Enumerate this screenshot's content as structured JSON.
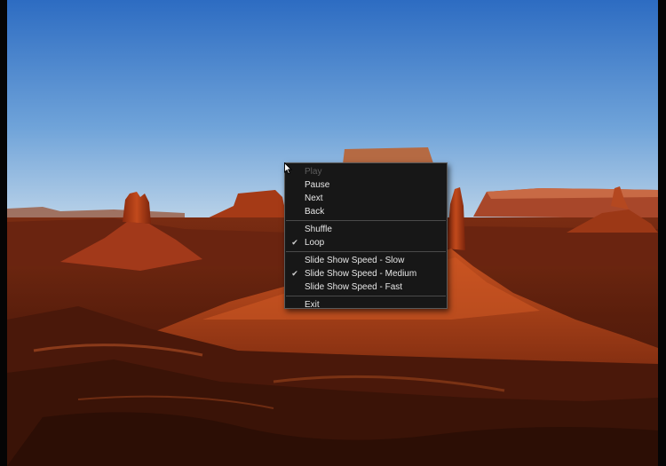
{
  "menu": {
    "items": [
      {
        "label": "Play",
        "enabled": false,
        "checked": false
      },
      {
        "label": "Pause",
        "enabled": true,
        "checked": false
      },
      {
        "label": "Next",
        "enabled": true,
        "checked": false
      },
      {
        "label": "Back",
        "enabled": true,
        "checked": false
      },
      {
        "label": "Shuffle",
        "enabled": true,
        "checked": false
      },
      {
        "label": "Loop",
        "enabled": true,
        "checked": true
      },
      {
        "label": "Slide Show Speed - Slow",
        "enabled": true,
        "checked": false
      },
      {
        "label": "Slide Show Speed - Medium",
        "enabled": true,
        "checked": true
      },
      {
        "label": "Slide Show Speed - Fast",
        "enabled": true,
        "checked": false
      },
      {
        "label": "Exit",
        "enabled": true,
        "checked": false
      }
    ],
    "check_glyph": "✔"
  },
  "colors": {
    "sky_top": "#2f6fc4",
    "sky_horizon": "#b9d4ea",
    "rock": "#b2401a",
    "menu_bg": "#171717"
  }
}
